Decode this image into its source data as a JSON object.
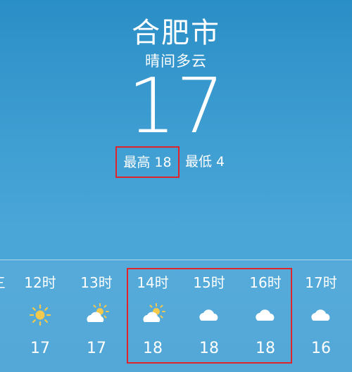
{
  "city": "合肥市",
  "condition": "晴间多云",
  "temperature": "17",
  "high": "最高 18",
  "low": "最低 4",
  "partial_label": "三",
  "hourly": [
    {
      "time": "12时",
      "icon": "sun-icon",
      "temp": "17"
    },
    {
      "time": "13时",
      "icon": "partly-cloudy-icon",
      "temp": "17"
    },
    {
      "time": "14时",
      "icon": "partly-cloudy-icon",
      "temp": "18"
    },
    {
      "time": "15时",
      "icon": "cloud-icon",
      "temp": "18"
    },
    {
      "time": "16时",
      "icon": "cloud-icon",
      "temp": "18"
    },
    {
      "time": "17时",
      "icon": "cloud-icon",
      "temp": "16"
    }
  ],
  "colors": {
    "highlight": "#e0242a",
    "sun": "#f2c94c",
    "cloud": "#ffffff"
  }
}
